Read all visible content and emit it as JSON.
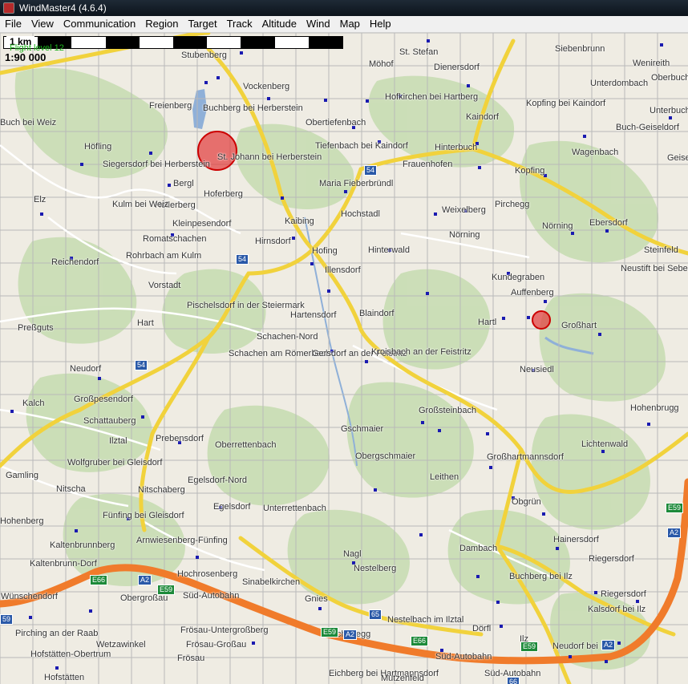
{
  "window": {
    "title": "WindMaster4 (4.6.4)"
  },
  "menu": [
    "File",
    "View",
    "Communication",
    "Region",
    "Target",
    "Track",
    "Altitude",
    "Wind",
    "Map",
    "Help"
  ],
  "map": {
    "scale_label": "1 km",
    "scale_ratio": "1:90 000",
    "flight_level": "Flight level 12",
    "places": [
      "Stubenberg",
      "St. Stefan",
      "Dienersdorf",
      "Siebenbrunn",
      "Wenireith",
      "Oberbuch",
      "Möhof",
      "Vockenberg",
      "Hofkirchen bei Hartberg",
      "Kaindorf",
      "Kopfing bei Kaindorf",
      "Unterdombach",
      "Unterbuch",
      "Freienberg",
      "Buchberg bei Herberstein",
      "Obertiefenbach",
      "Buch-Geiseldorf",
      "Buch bei Weiz",
      "Höfling",
      "Siegersdorf bei Herberstein",
      "St. Johann bei Herberstein",
      "Tiefenbach bei Kaindorf",
      "Hinterbuch",
      "Wagenbach",
      "Geiseldorf",
      "Bergl",
      "Maria Fieberbründl",
      "Frauenhofen",
      "Kopfing",
      "Elz",
      "Hoferberg",
      "Hollerberg",
      "Kulm bei Weiz",
      "Kaibing",
      "Hochstadl",
      "Weixelberg",
      "Pirchegg",
      "Ebersdorf",
      "Kleinpesendorf",
      "Nörning",
      "Nörning",
      "Romatschachen",
      "Hirnsdorf",
      "Hofing",
      "Hinterwald",
      "Steinfeld",
      "Reichendorf",
      "Rohrbach am Kulm",
      "Illensdorf",
      "Kundegraben",
      "Neustift bei Sebersdorf",
      "Auffenberg",
      "Vorstadt",
      "Pischelsdorf in der Steiermark",
      "Hartensdorf",
      "Blaindorf",
      "Hartl",
      "Großhart",
      "Preßguts",
      "Hart",
      "Schachen-Nord",
      "Schachen am Römerbach",
      "Gersdorf an der Feistritz",
      "Kroisbach an der Feistritz",
      "Neusiedl",
      "Neudorf",
      "Großpesendorf",
      "Kalch",
      "Schattauberg",
      "Großsteinbach",
      "Hohenbrugg",
      "Ilztal",
      "Prebensdorf",
      "Oberrettenbach",
      "Gschmaier",
      "Obergschmaier",
      "Großhartmannsdorf",
      "Lichtenwald",
      "Gamling",
      "Wolfgruber bei Gleisdorf",
      "Egelsdorf-Nord",
      "Leithen",
      "Nitscha",
      "Nitschaberg",
      "Egelsdorf",
      "Unterrettenbach",
      "Obgrün",
      "Hohenberg",
      "Fünfing bei Gleisdorf",
      "Kaltenbrunnberg",
      "Arnwiesenberg-Fünfing",
      "Dambach",
      "Hainersdorf",
      "Nagl",
      "Kaltenbrunn-Dorf",
      "Nestelberg",
      "Riegersdorf",
      "Hochrosenberg",
      "Sinabelkirchen",
      "Buchberg bei Ilz",
      "Wünschendorf",
      "Obergroßau",
      "Gnies",
      "Riegersdorf",
      "Süd-Autobahn",
      "Kalsdorf bei Ilz",
      "Nestelbach im Ilztal",
      "Dörfl",
      "Pirching an der Raab",
      "Frösau-Untergroßberg",
      "Hochenegg",
      "Ilz",
      "Wetzawinkel",
      "Frösau-Großau",
      "Neudorf bei Ilz",
      "Hofstätten-Obertrum",
      "Frösau",
      "Eichberg bei Hartmannsdorf",
      "Hofstätten",
      "Mutzenfeld",
      "Süd-Autobahn",
      "Süd-Autobahn"
    ],
    "shields": [
      "54",
      "54",
      "54",
      "E66",
      "A2",
      "E59",
      "65",
      "A2",
      "E59",
      "E66",
      "E59",
      "66",
      "A2",
      "E59",
      "A2",
      "59"
    ],
    "colors": {
      "forest": "#c5dcb0",
      "field": "#efece3",
      "road_main": "#fbe15a",
      "road_minor": "#ffffff",
      "motorway": "#f07b2b",
      "grid": "#b9b9b9",
      "water": "#8fb0d8",
      "target_fill": "#e23a3a",
      "marker": "#1a1ab0"
    },
    "targets": [
      "large-target",
      "small-target"
    ]
  }
}
